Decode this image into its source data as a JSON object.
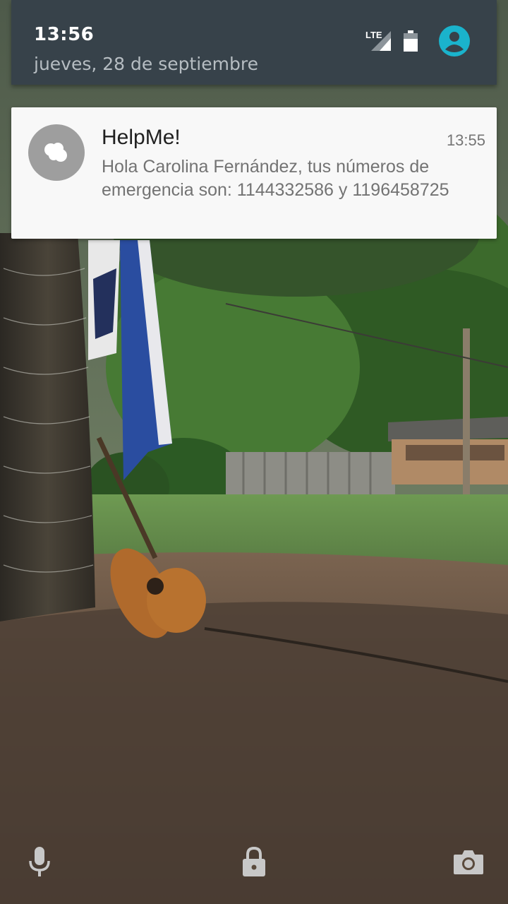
{
  "status_bar": {
    "time": "13:56",
    "date": "jueves, 28 de septiembre",
    "network_label": "LTE",
    "icons": [
      "lte-signal-icon",
      "battery-icon",
      "user-avatar-icon"
    ],
    "avatar_color": "#1ab3cc"
  },
  "notification": {
    "app_name": "HelpMe!",
    "time": "13:55",
    "message": "Hola Carolina Fernández, tus números de emergencia son: 1144332586 y 1196458725",
    "icon": "app-logo-icon"
  },
  "bottom_actions": {
    "left_icon": "microphone-icon",
    "center_icon": "lock-icon",
    "right_icon": "camera-icon"
  },
  "colors": {
    "header_background": "#37424a",
    "card_background": "#f8f8f8",
    "title_text": "#212121",
    "body_text": "#737373"
  }
}
